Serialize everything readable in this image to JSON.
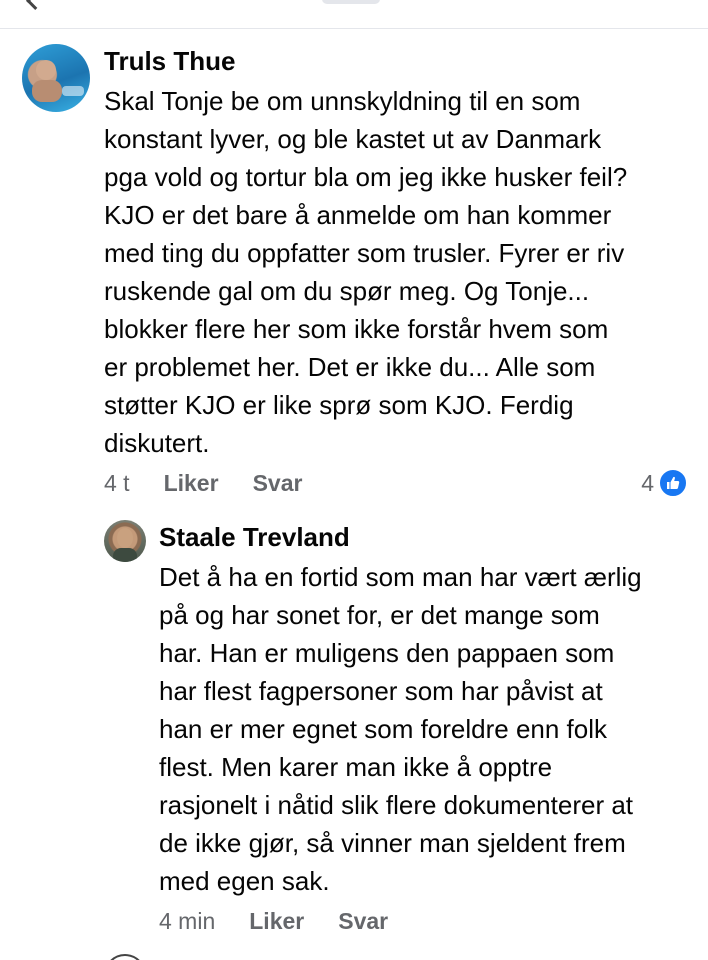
{
  "comments": [
    {
      "author": "Truls Thue",
      "body_lines": [
        "Skal Tonje be om unnskyldning til en som",
        "konstant lyver, og ble kastet ut av Danmark",
        "pga vold og tortur bla om jeg ikke husker feil?",
        "KJO er det bare å anmelde om han kommer",
        "med ting du oppfatter som trusler. Fyrer er riv",
        "ruskende gal om du spør meg. Og Tonje...",
        "blokker flere her som ikke forstår hvem som",
        "er problemet her. Det er ikke du... Alle som",
        "støtter KJO er like sprø som KJO. Ferdig",
        "diskutert."
      ],
      "time": "4 t",
      "like_label": "Liker",
      "reply_label": "Svar",
      "reaction_count": "4",
      "reaction_icon": "like-thumb-icon",
      "accent_color": "#1877f2"
    },
    {
      "author": "Staale Trevland",
      "body_lines": [
        "Det å ha en fortid som man har vært ærlig",
        "på og har sonet for, er det mange som",
        "har. Han er muligens den pappaen som",
        "har flest fagpersoner som har påvist at",
        "han er mer egnet som foreldre enn folk",
        "flest. Men karer man ikke å opptre",
        "rasjonelt i nåtid slik flere dokumenterer at",
        "de ikke gjør, så vinner man sjeldent frem",
        "med egen sak."
      ],
      "time": "4 min",
      "like_label": "Liker",
      "reply_label": "Svar"
    }
  ]
}
